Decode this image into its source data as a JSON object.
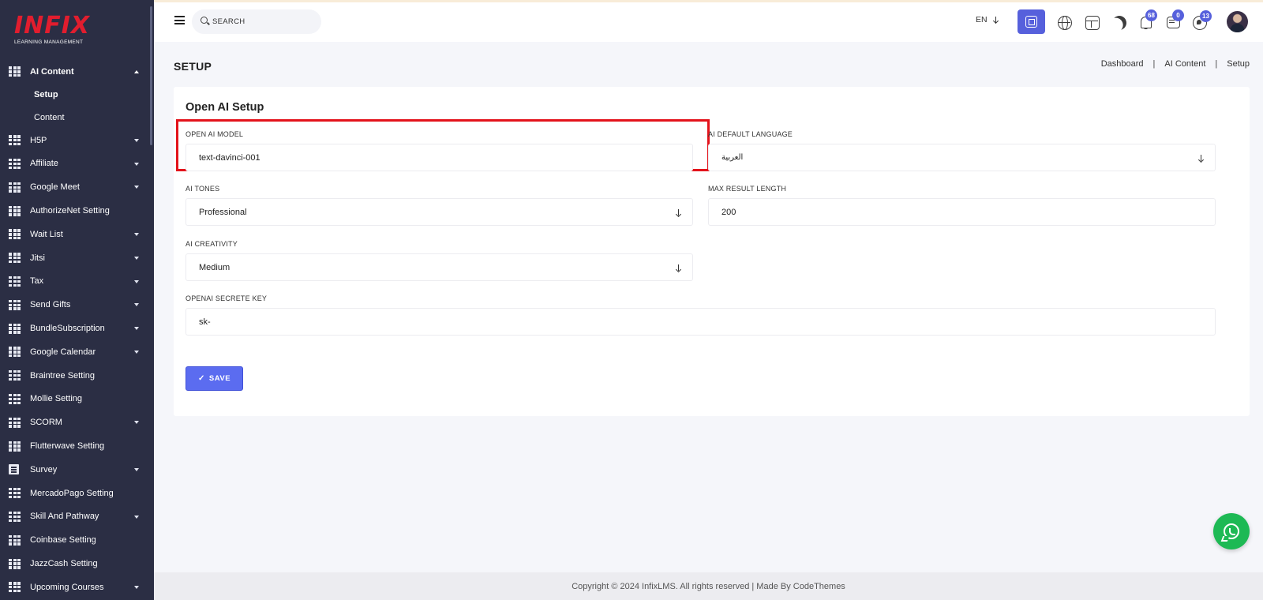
{
  "brand": {
    "name": "INFIX",
    "tagline": "LEARNING MANAGEMENT"
  },
  "sidebar": {
    "open_menu": {
      "label": "AI Content",
      "submenu": [
        "Setup",
        "Content"
      ],
      "active": "Setup"
    },
    "items": [
      {
        "label": "H5P",
        "has_caret": true
      },
      {
        "label": "Affiliate",
        "has_caret": true
      },
      {
        "label": "Google Meet",
        "has_caret": true
      },
      {
        "label": "AuthorizeNet Setting",
        "has_caret": false
      },
      {
        "label": "Wait List",
        "has_caret": true
      },
      {
        "label": "Jitsi",
        "has_caret": true
      },
      {
        "label": "Tax",
        "has_caret": true
      },
      {
        "label": "Send Gifts",
        "has_caret": true
      },
      {
        "label": "BundleSubscription",
        "has_caret": true
      },
      {
        "label": "Google Calendar",
        "has_caret": true
      },
      {
        "label": "Braintree Setting",
        "has_caret": false
      },
      {
        "label": "Mollie Setting",
        "has_caret": false
      },
      {
        "label": "SCORM",
        "has_caret": true
      },
      {
        "label": "Flutterwave Setting",
        "has_caret": false
      },
      {
        "label": "Survey",
        "has_caret": true
      },
      {
        "label": "MercadoPago Setting",
        "has_caret": false
      },
      {
        "label": "Skill And Pathway",
        "has_caret": true
      },
      {
        "label": "Coinbase Setting",
        "has_caret": false
      },
      {
        "label": "JazzCash Setting",
        "has_caret": false
      },
      {
        "label": "Upcoming Courses",
        "has_caret": true
      }
    ]
  },
  "header": {
    "search_placeholder": "SEARCH",
    "language": "EN",
    "badges": {
      "notifications": "68",
      "messages": "0",
      "whatsapp": "13"
    },
    "accent_color": "#5660dc"
  },
  "page": {
    "title": "SETUP",
    "breadcrumb": [
      "Dashboard",
      "AI Content",
      "Setup"
    ]
  },
  "form": {
    "title": "Open AI Setup",
    "openai_model": {
      "label": "OPEN AI MODEL",
      "value": "text-davinci-001"
    },
    "default_language": {
      "label": "AI DEFAULT LANGUAGE",
      "value": "العربية"
    },
    "tones": {
      "label": "AI TONES",
      "value": "Professional"
    },
    "max_length": {
      "label": "MAX RESULT LENGTH",
      "value": "200"
    },
    "creativity": {
      "label": "AI CREATIVITY",
      "value": "Medium"
    },
    "secret_key": {
      "label": "OPENAI SECRETE KEY",
      "value": "sk-"
    },
    "save_label": "SAVE"
  },
  "footer": {
    "text": "Copyright © 2024 InfixLMS. All rights reserved | Made By CodeThemes"
  }
}
